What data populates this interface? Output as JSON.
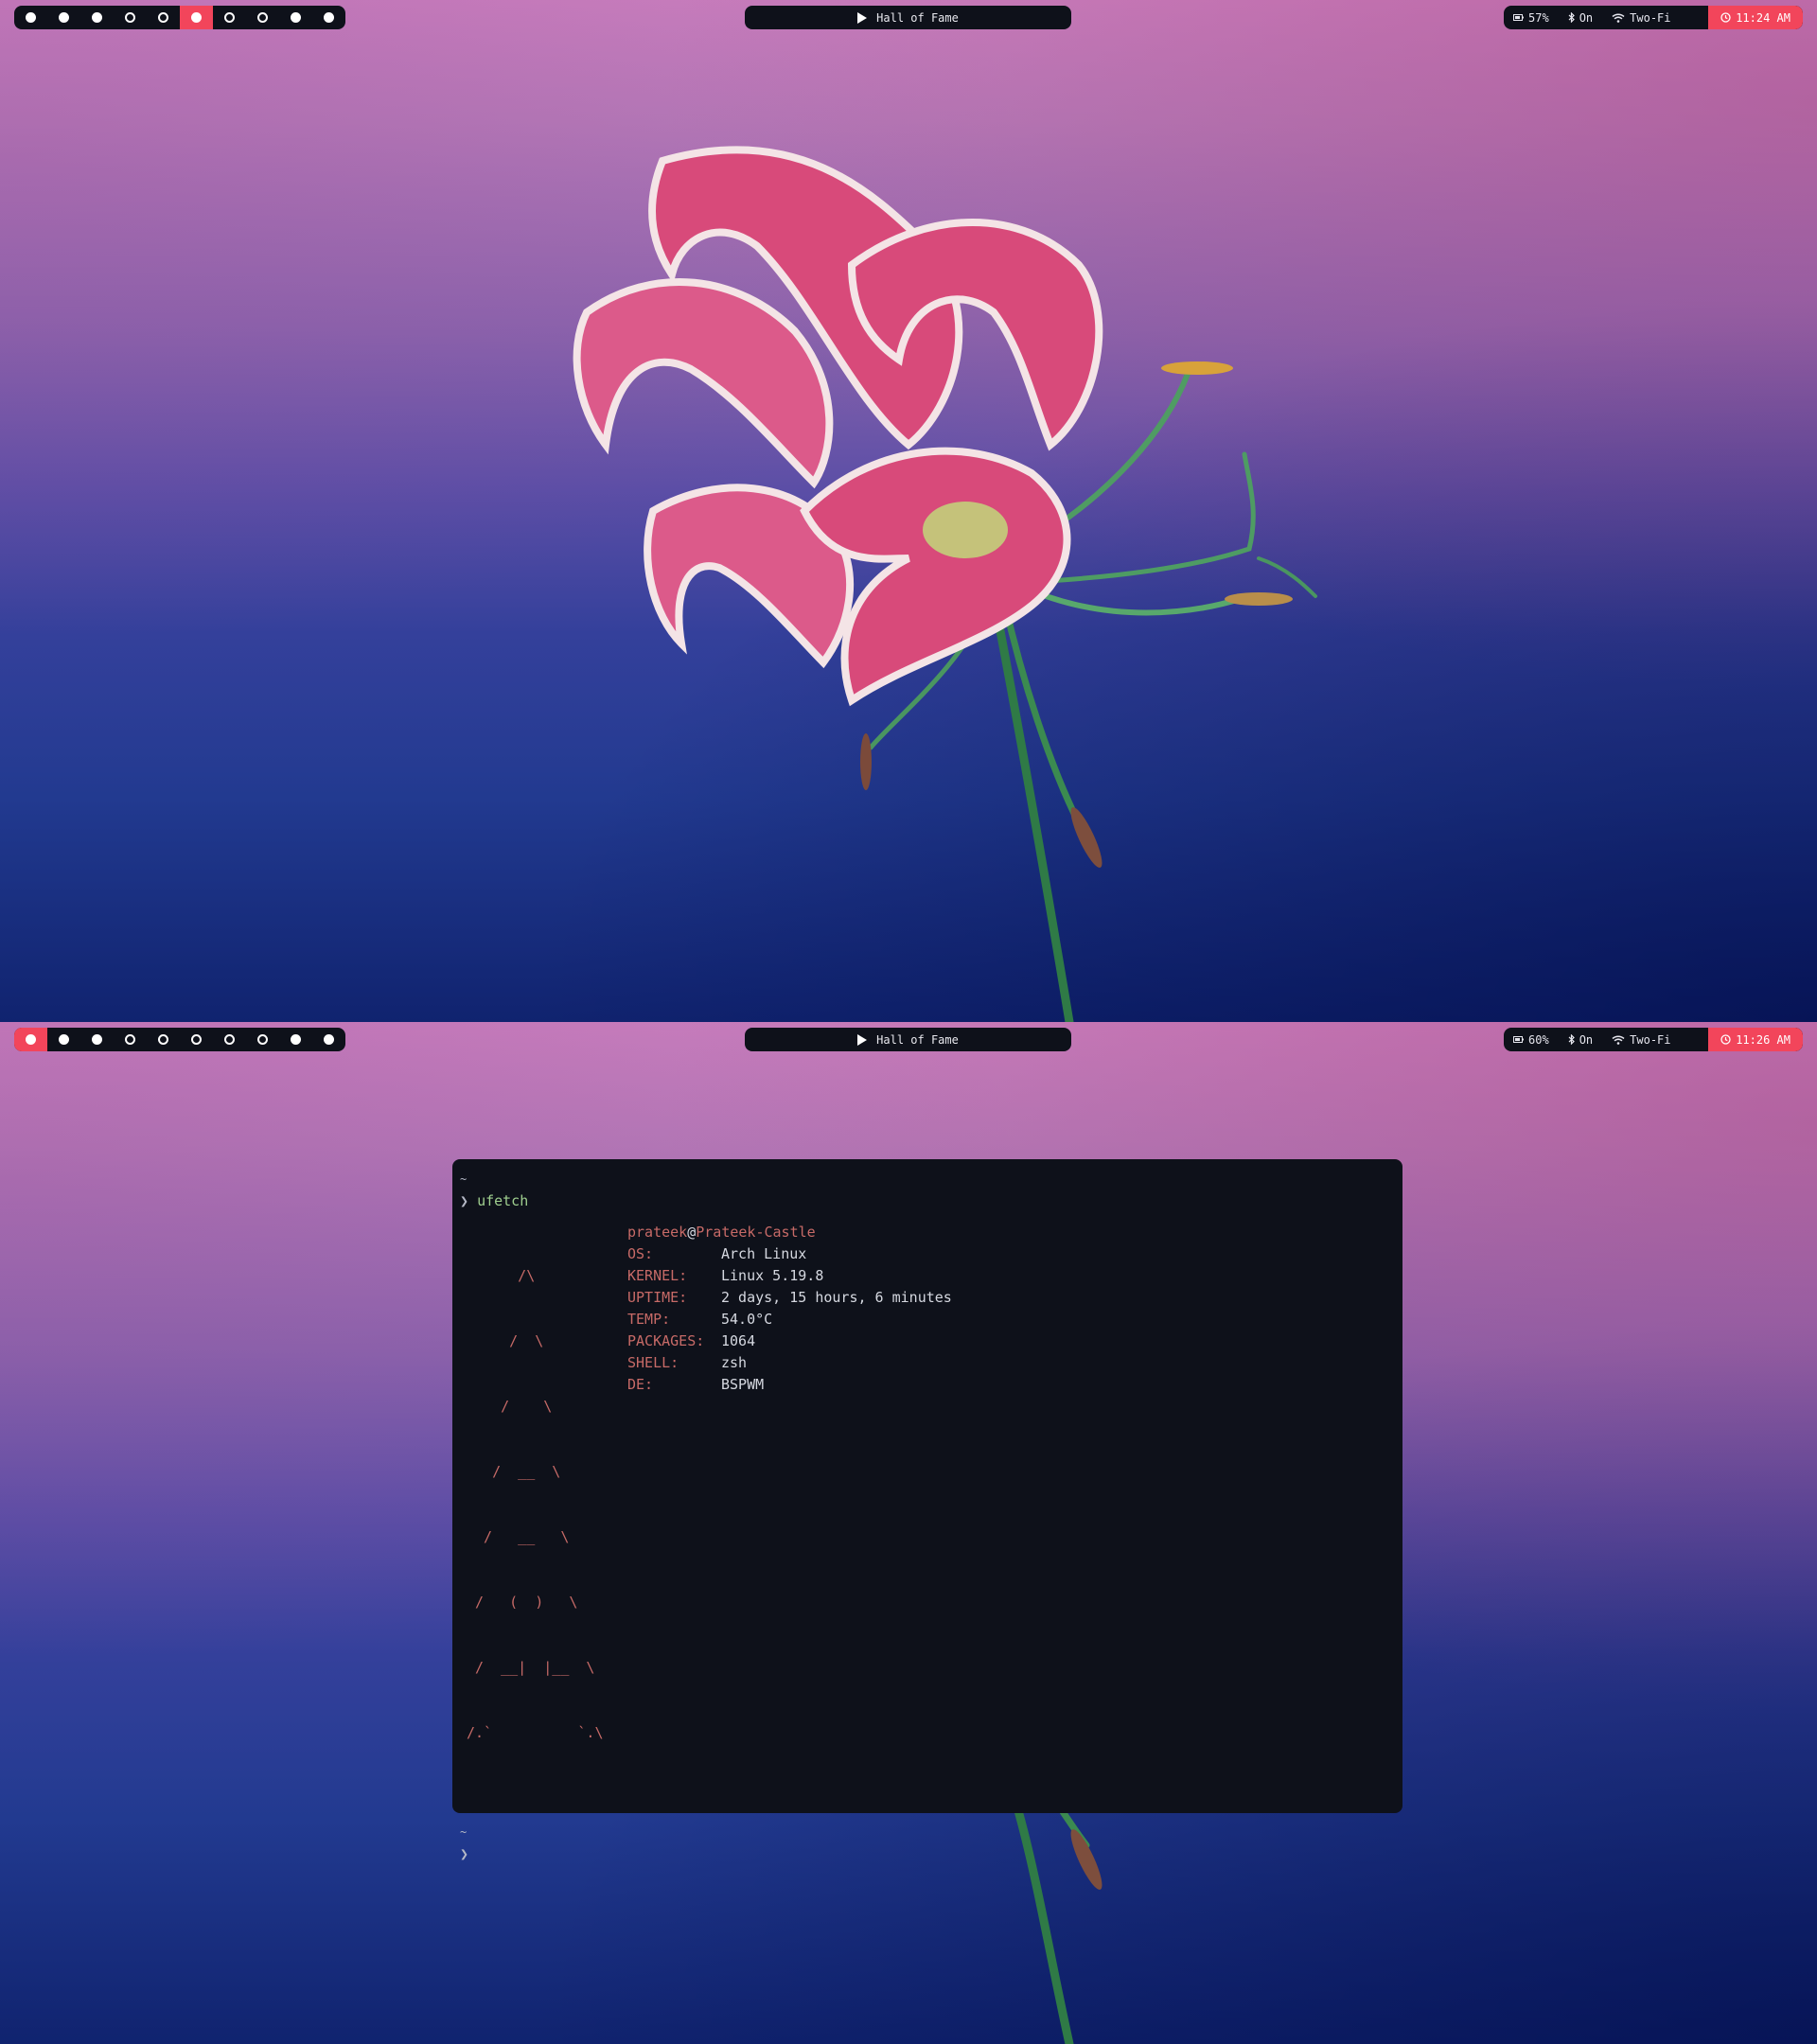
{
  "screens": [
    {
      "workspaces": [
        {
          "state": "filled",
          "active": false
        },
        {
          "state": "filled",
          "active": false
        },
        {
          "state": "filled",
          "active": false
        },
        {
          "state": "empty",
          "active": false
        },
        {
          "state": "empty",
          "active": false
        },
        {
          "state": "filled",
          "active": true
        },
        {
          "state": "empty",
          "active": false
        },
        {
          "state": "empty",
          "active": false
        },
        {
          "state": "filled",
          "active": false
        },
        {
          "state": "filled",
          "active": false
        }
      ],
      "media": {
        "title": "Hall of Fame",
        "icon": "play-icon"
      },
      "status": {
        "battery": "57%",
        "bluetooth": "On",
        "wifi": "Two-Fi",
        "clock": "11:24 AM"
      }
    },
    {
      "workspaces": [
        {
          "state": "filled",
          "active": true
        },
        {
          "state": "filled",
          "active": false
        },
        {
          "state": "filled",
          "active": false
        },
        {
          "state": "empty",
          "active": false
        },
        {
          "state": "empty",
          "active": false
        },
        {
          "state": "empty",
          "active": false
        },
        {
          "state": "empty",
          "active": false
        },
        {
          "state": "empty",
          "active": false
        },
        {
          "state": "filled",
          "active": false
        },
        {
          "state": "filled",
          "active": false
        }
      ],
      "media": {
        "title": "Hall of Fame",
        "icon": "play-icon"
      },
      "status": {
        "battery": "60%",
        "bluetooth": "On",
        "wifi": "Two-Fi",
        "clock": "11:26 AM"
      },
      "terminal": {
        "cwd": "~",
        "prompt": "❯",
        "command": "ufetch",
        "ascii_art": [
          "      /\\",
          "     /  \\",
          "    /    \\",
          "   /  __  \\",
          "  /   __   \\",
          " /   (  )   \\",
          " /  __|  |__  \\",
          "/.`          `.\\"
        ],
        "user": "prateek",
        "host": "Prateek-Castle",
        "info": [
          {
            "key": "OS:",
            "value": "Arch Linux"
          },
          {
            "key": "KERNEL:",
            "value": "Linux 5.19.8"
          },
          {
            "key": "UPTIME:",
            "value": "2 days, 15 hours, 6 minutes"
          },
          {
            "key": "TEMP:",
            "value": "54.0°C"
          },
          {
            "key": "PACKAGES:",
            "value": "1064"
          },
          {
            "key": "SHELL:",
            "value": "zsh"
          },
          {
            "key": "DE:",
            "value": "BSPWM"
          }
        ],
        "next_cwd": "~",
        "next_prompt": "❯"
      }
    }
  ],
  "colors": {
    "accent": "#f2455b",
    "bar_bg": "#0e111a",
    "terminal_bg": "#0e111a",
    "fetch_key": "#c76a67",
    "command": "#9fcf8f"
  }
}
